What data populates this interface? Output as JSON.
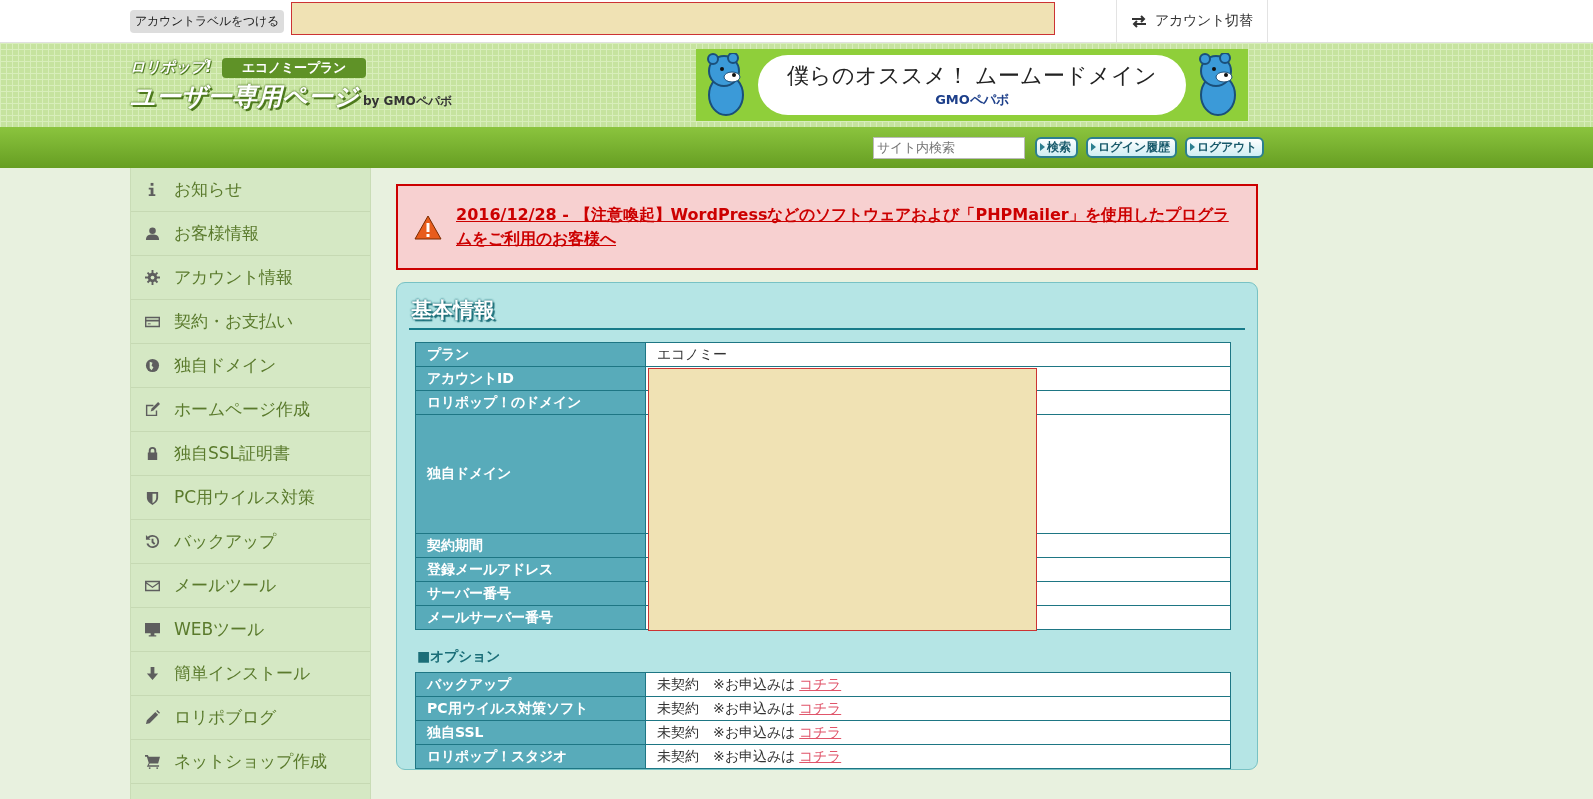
{
  "top_bar": {
    "label_button": "アカウントラベルをつける",
    "label_field": {
      "redacted": true
    },
    "account_switch": "アカウント切替"
  },
  "header": {
    "logo": {
      "brand": "ロリポップ!",
      "plan": "エコノミープラン",
      "title": "ユーザー専用ページ",
      "by": "by GMOペパボ"
    },
    "banner": {
      "headline": "僕らのオススメ！ ムームードメイン",
      "company": "GMOペパボ"
    }
  },
  "nav": {
    "search": {
      "placeholder": "サイト内検索"
    },
    "buttons": [
      "検索",
      "ログイン履歴",
      "ログアウト"
    ]
  },
  "sidebar": {
    "items": [
      {
        "label": "お知らせ"
      },
      {
        "label": "お客様情報"
      },
      {
        "label": "アカウント情報"
      },
      {
        "label": "契約・お支払い"
      },
      {
        "label": "独自ドメイン"
      },
      {
        "label": "ホームページ作成"
      },
      {
        "label": "独自SSL証明書"
      },
      {
        "label": "PC用ウイルス対策"
      },
      {
        "label": "バックアップ"
      },
      {
        "label": "メールツール"
      },
      {
        "label": "WEBツール"
      },
      {
        "label": "簡単インストール"
      },
      {
        "label": "ロリポブログ"
      },
      {
        "label": "ネットショップ作成"
      }
    ]
  },
  "alert": {
    "text": "2016/12/28 - 【注意喚起】WordPressなどのソフトウェアおよび「PHPMailer」を使用したプログラムをご利用のお客様へ"
  },
  "basic_info": {
    "title": "基本情報",
    "redacted": true,
    "rows": [
      {
        "label": "プラン",
        "value": "エコノミー"
      },
      {
        "label": "アカウントID"
      },
      {
        "label": "ロリポップ！のドメイン"
      },
      {
        "label": "独自ドメイン"
      },
      {
        "label": "契約期間"
      },
      {
        "label": "登録メールアドレス"
      },
      {
        "label": "サーバー番号"
      },
      {
        "label": "メールサーバー番号"
      }
    ],
    "options_heading": "■オプション",
    "options": [
      {
        "label": "バックアップ",
        "status": "未契約",
        "note": "※お申込みは",
        "link": "コチラ"
      },
      {
        "label": "PC用ウイルス対策ソフト",
        "status": "未契約",
        "note": "※お申込みは",
        "link": "コチラ"
      },
      {
        "label": "独自SSL",
        "status": "未契約",
        "note": "※お申込みは",
        "link": "コチラ"
      },
      {
        "label": "ロリポップ！スタジオ",
        "status": "未契約",
        "note": "※お申込みは",
        "link": "コチラ"
      }
    ]
  }
}
